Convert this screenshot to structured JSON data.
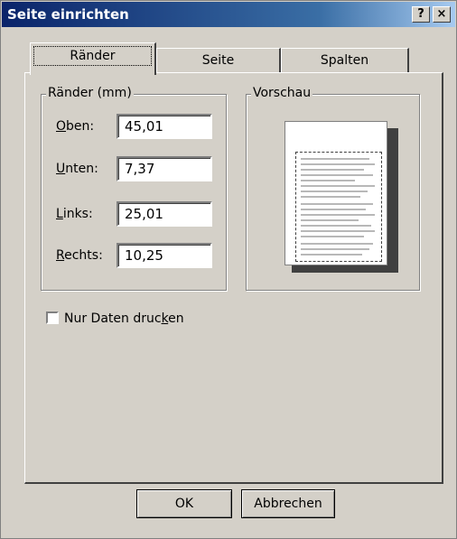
{
  "window": {
    "title": "Seite einrichten",
    "help_button": "?",
    "close_button": "×"
  },
  "tabs": [
    {
      "label": "Ränder",
      "active": true
    },
    {
      "label": "Seite",
      "active": false
    },
    {
      "label": "Spalten",
      "active": false
    }
  ],
  "margins_group": {
    "label": "Ränder (mm)",
    "fields": [
      {
        "label": "Oben:",
        "access_key": "O",
        "rest": "ben:",
        "value": "45,01"
      },
      {
        "label": "Unten:",
        "access_key": "U",
        "rest": "nten:",
        "value": "7,37"
      },
      {
        "label": "Links:",
        "access_key": "L",
        "rest": "inks:",
        "value": "25,01"
      },
      {
        "label": "Rechts:",
        "access_key": "R",
        "rest": "echts:",
        "value": "10,25"
      }
    ]
  },
  "preview_group": {
    "label": "Vorschau"
  },
  "checkbox": {
    "label_before": "Nur Daten druc",
    "label_key": "k",
    "label_after": "en",
    "checked": false
  },
  "buttons": {
    "ok": "OK",
    "cancel": "Abbrechen"
  }
}
